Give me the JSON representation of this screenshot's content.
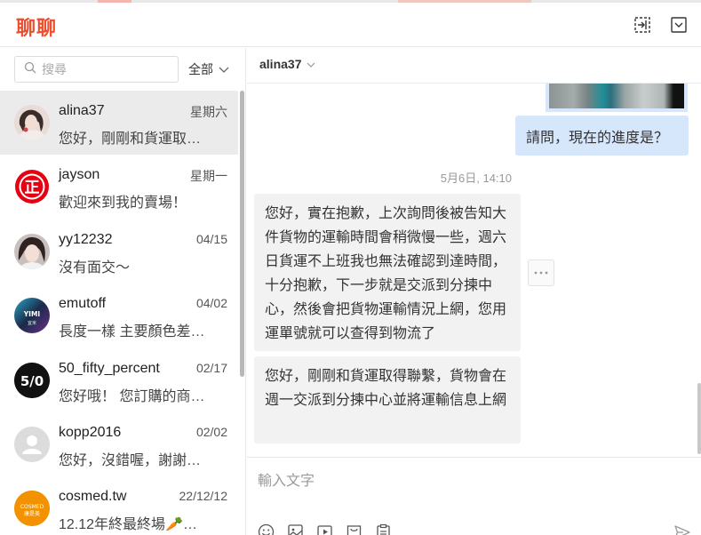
{
  "app": {
    "title": "聊聊"
  },
  "sidebar": {
    "search_placeholder": "搜尋",
    "filter_label": "全部",
    "conversations": [
      {
        "name": "alina37",
        "date": "星期六",
        "preview": "您好，剛剛和貨運取…",
        "avatar": "photo-woman"
      },
      {
        "name": "jayson",
        "date": "星期一",
        "preview": "歡迎來到我的賣場！",
        "avatar": "正"
      },
      {
        "name": "yy12232",
        "date": "04/15",
        "preview": "沒有面交～",
        "avatar": "photo-girl"
      },
      {
        "name": "emutoff",
        "date": "04/02",
        "preview": "長度一樣 主要顏色差…",
        "avatar": "YIMI",
        "avatar_sub": "宜米"
      },
      {
        "name": "50_fifty_percent",
        "date": "02/17",
        "preview": "您好哦！ 您訂購的商…",
        "avatar": "5/0"
      },
      {
        "name": "kopp2016",
        "date": "02/02",
        "preview": "您好，沒錯喔，謝謝…",
        "avatar": "default-user"
      },
      {
        "name": "cosmed.tw",
        "date": "22/12/12",
        "preview": "12.12年終最終場🥕…",
        "avatar": "COSMED",
        "avatar_sub": "康是美"
      }
    ]
  },
  "chat": {
    "username": "alina37",
    "outgoing_message": "請問，現在的進度是？",
    "timestamp": "5月6日, 14:10",
    "incoming_messages": [
      "您好，實在抱歉，上次詢問後被告知大件貨物的運輸時間會稍微慢一些，週六日貨運不上班我也無法確認到達時間，十分抱歉，下一步就是交派到分揀中心，然後會把貨物運輸情況上網，您用運單號就可以查得到物流了",
      "您好，剛剛和貨運取得聯繫，貨物會在週一交派到分揀中心並將運輸信息上網"
    ],
    "input_placeholder": "輸入文字"
  },
  "colors": {
    "brand": "#ee4d2d",
    "outgoing_bubble": "#d6e6fb",
    "incoming_bubble": "#f2f2f2",
    "active_row": "#ebebeb"
  },
  "icons": [
    "collapse-icon",
    "minimize-icon",
    "search-icon",
    "chevron-down-icon",
    "emoji-icon",
    "sticker-icon",
    "video-icon",
    "product-icon",
    "order-icon",
    "send-icon",
    "more-icon"
  ]
}
